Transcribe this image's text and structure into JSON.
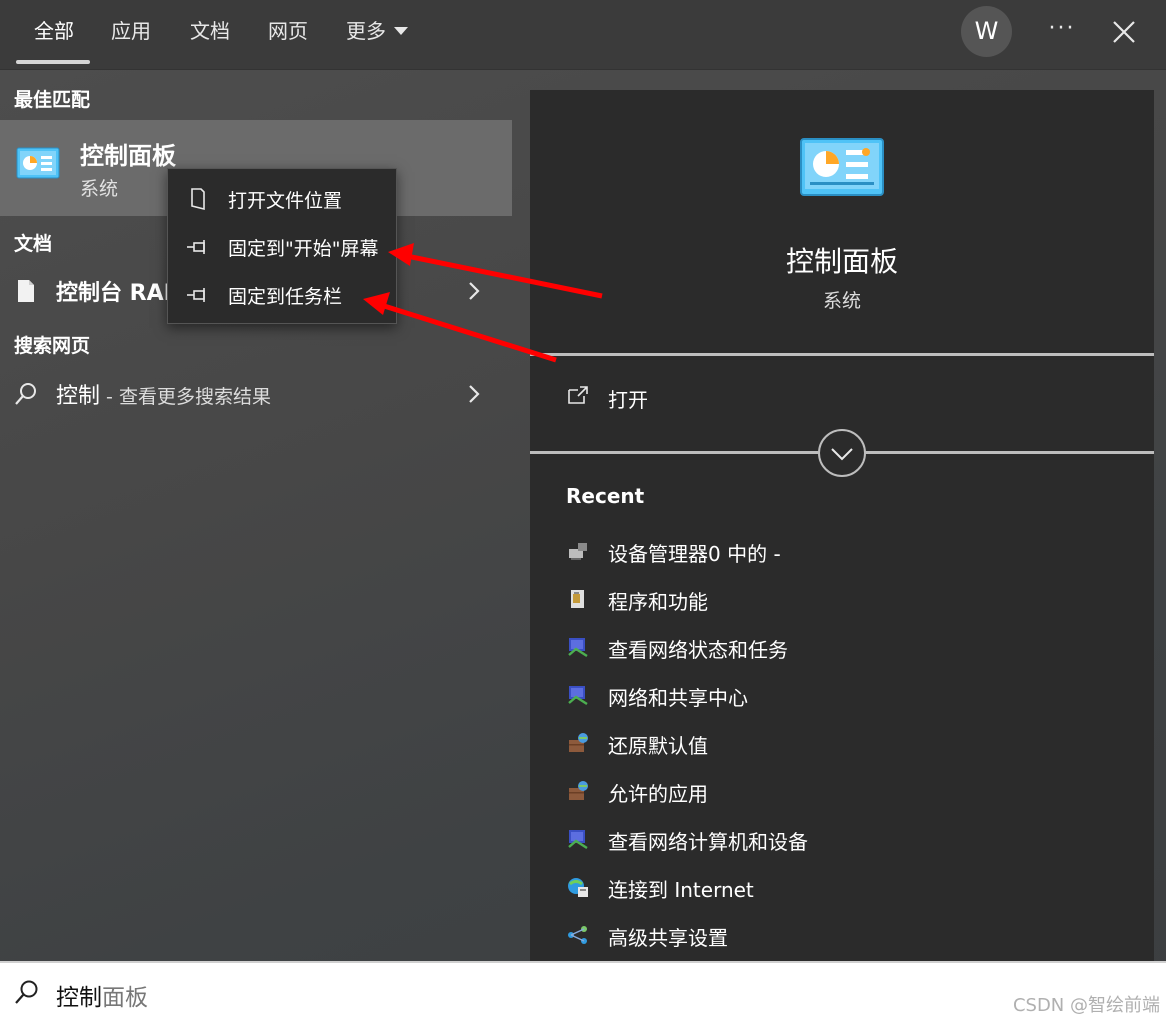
{
  "tabs": [
    {
      "label": "全部"
    },
    {
      "label": "应用"
    },
    {
      "label": "文档"
    },
    {
      "label": "网页"
    },
    {
      "label": "更多"
    }
  ],
  "account": {
    "initial": "W"
  },
  "more_options_label": "···",
  "left": {
    "best_match_heading": "最佳匹配",
    "best_match": {
      "title": "控制面板",
      "subtitle": "系统",
      "icon": "control-panel-icon"
    },
    "documents_heading": "文档",
    "document_item": {
      "label": "控制台 RAI",
      "icon": "document-icon"
    },
    "web_heading": "搜索网页",
    "web_item": {
      "query": "控制",
      "suffix": " - 查看更多搜索结果",
      "icon": "search-icon"
    }
  },
  "context_menu": {
    "items": [
      {
        "label": "打开文件位置",
        "icon": "file-location-icon"
      },
      {
        "label": "固定到\"开始\"屏幕",
        "icon": "pin-icon"
      },
      {
        "label": "固定到任务栏",
        "icon": "pin-icon"
      }
    ]
  },
  "right": {
    "title": "控制面板",
    "subtitle": "系统",
    "open_label": "打开",
    "recent_heading": "Recent",
    "recent": [
      {
        "label": "设备管理器0 中的 -",
        "icon": "device-manager-icon"
      },
      {
        "label": "程序和功能",
        "icon": "programs-icon"
      },
      {
        "label": "查看网络状态和任务",
        "icon": "network-icon"
      },
      {
        "label": "网络和共享中心",
        "icon": "network-icon"
      },
      {
        "label": "还原默认值",
        "icon": "firewall-icon"
      },
      {
        "label": "允许的应用",
        "icon": "firewall-icon"
      },
      {
        "label": "查看网络计算机和设备",
        "icon": "network-icon"
      },
      {
        "label": "连接到 Internet",
        "icon": "internet-icon"
      },
      {
        "label": "高级共享设置",
        "icon": "sharing-icon"
      }
    ]
  },
  "search": {
    "typed": "控制",
    "suggestion": "面板"
  },
  "watermark": "CSDN @智绘前端",
  "colors": {
    "arrow": "#ff0000",
    "panel": "#2b2b2b",
    "selected": "#6b6b6b"
  }
}
